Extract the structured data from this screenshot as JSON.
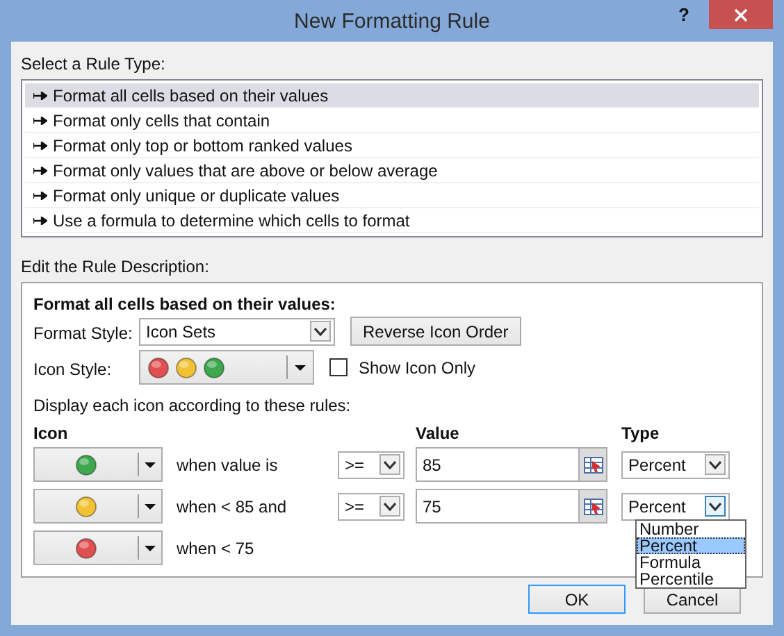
{
  "window": {
    "title": "New Formatting Rule",
    "help": "?"
  },
  "rule_type_section": {
    "label": "Select a Rule Type:",
    "items": [
      {
        "label": "Format all cells based on their values",
        "selected": true
      },
      {
        "label": "Format only cells that contain",
        "selected": false
      },
      {
        "label": "Format only top or bottom ranked values",
        "selected": false
      },
      {
        "label": "Format only values that are above or below average",
        "selected": false
      },
      {
        "label": "Format only unique or duplicate values",
        "selected": false
      },
      {
        "label": "Use a formula to determine which cells to format",
        "selected": false
      }
    ]
  },
  "description_section": {
    "label": "Edit the Rule Description:",
    "heading": "Format all cells based on their values:",
    "format_style": {
      "label": "Format Style:",
      "value": "Icon Sets"
    },
    "reverse_button": "Reverse Icon Order",
    "icon_style": {
      "label": "Icon Style:",
      "icons": [
        {
          "color": "#e05050"
        },
        {
          "color": "#f2c232"
        },
        {
          "color": "#3ea84e"
        }
      ]
    },
    "show_icon_only": {
      "label": "Show Icon Only",
      "checked": false
    },
    "rules_label": "Display each icon according to these rules:",
    "columns": {
      "icon": "Icon",
      "value": "Value",
      "type": "Type"
    },
    "icon_rules": [
      {
        "color": "#3ea84e",
        "condition": "when value is",
        "operator": ">=",
        "value": "85",
        "type": "Percent",
        "open": false
      },
      {
        "color": "#f2c232",
        "condition": "when < 85 and",
        "operator": ">=",
        "value": "75",
        "type": "Percent",
        "open": true,
        "options": [
          {
            "label": "Number",
            "selected": false
          },
          {
            "label": "Percent",
            "selected": true
          },
          {
            "label": "Formula",
            "selected": false
          },
          {
            "label": "Percentile",
            "selected": false
          }
        ]
      },
      {
        "color": "#e05050",
        "condition": "when < 75"
      }
    ]
  },
  "buttons": [
    {
      "label": "OK",
      "default": true
    },
    {
      "label": "Cancel",
      "default": false
    }
  ]
}
